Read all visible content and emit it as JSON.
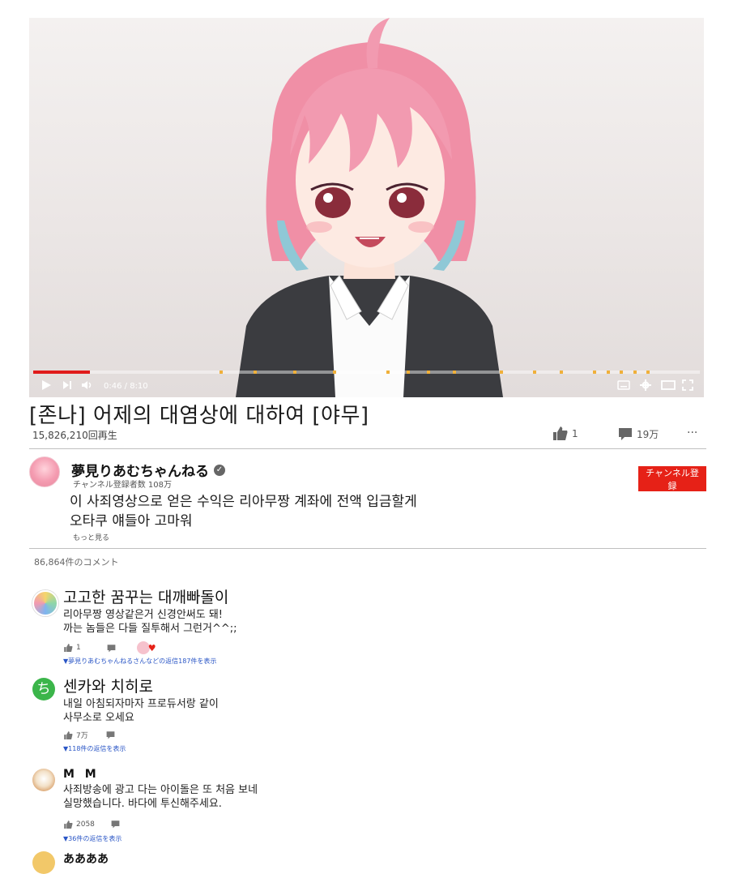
{
  "player": {
    "time_current": "0:46",
    "time_total": "8:10",
    "progress": 0.085,
    "ad_markers": [
      0.28,
      0.33,
      0.39,
      0.45,
      0.53,
      0.56,
      0.59,
      0.63,
      0.7,
      0.75,
      0.79,
      0.84,
      0.86,
      0.88,
      0.9,
      0.92
    ]
  },
  "video": {
    "title": "[존나] 어제의 대염상에 대하여 [야무]",
    "views": "15,826,210回再生",
    "likes": "1",
    "comments_count_short": "19万",
    "more_symbol": "···"
  },
  "channel": {
    "name": "夢見りあむちゃんねる",
    "subscribers": "チャンネル登録者数 108万",
    "subscribe_label": "チャンネル登録",
    "description_lines": [
      "이 사죄영상으로 얻은 수익은 리아무짱 계좌에 전액 입금할게",
      "오타쿠 얘들아 고마워"
    ],
    "more_label": "もっと見る"
  },
  "comments_header": "86,864件のコメント",
  "comments": [
    {
      "author": "고고한 꿈꾸는 대깨빠돌이",
      "lines": [
        "리아무짱 영상같은거 신경안써도 돼!",
        "까는 놈들은 다들 질투해서 그런거^^;;"
      ],
      "likes": "1",
      "replies": "▼夢見りあむちゃんねるさんなどの返信187件を表示"
    },
    {
      "author": "센카와 치히로",
      "avatar_letter": "ち",
      "lines": [
        "내일 아침되자마자 프로듀서랑 같이",
        "사무소로 오세요"
      ],
      "likes": "7万",
      "replies": "▼118件の返信を表示"
    },
    {
      "author": "M M",
      "lines": [
        "사죄방송에 광고 다는 아이돌은 또 처음 보네",
        "실망했습니다. 바다에 투신해주세요."
      ],
      "likes": "2058",
      "replies": "▼36件の返信を表示"
    },
    {
      "author": "ああああ"
    }
  ],
  "colors": {
    "accent": "#e62117",
    "progress": "#e01b1b",
    "ad_marker": "#f0b03a",
    "link": "#2a56c6"
  }
}
